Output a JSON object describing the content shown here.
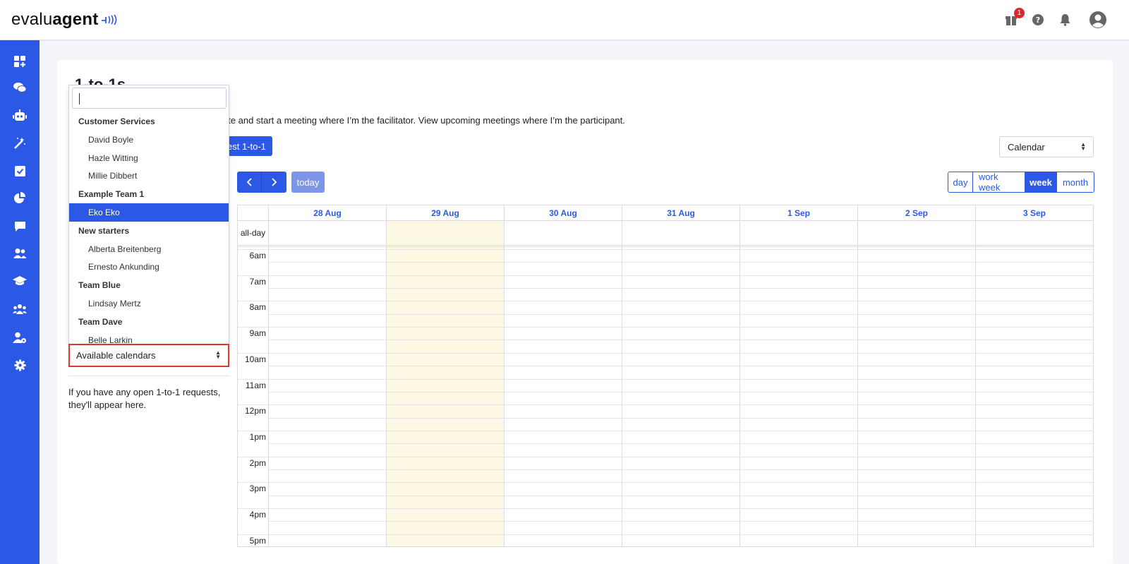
{
  "header": {
    "logo_regular": "evalu",
    "logo_bold": "agent",
    "notification_count": "1",
    "icons": [
      "gift-icon",
      "help-icon",
      "bell-icon",
      "user-avatar-icon"
    ]
  },
  "sidebar": {
    "items": [
      {
        "name": "dashboard-add-icon"
      },
      {
        "name": "chat-bubbles-icon"
      },
      {
        "name": "robot-icon"
      },
      {
        "name": "magic-wand-icon"
      },
      {
        "name": "checkbox-icon"
      },
      {
        "name": "pie-chart-icon"
      },
      {
        "name": "comment-icon"
      },
      {
        "name": "users-icon"
      },
      {
        "name": "graduation-cap-icon"
      },
      {
        "name": "team-icon"
      },
      {
        "name": "user-settings-icon"
      },
      {
        "name": "gear-icon"
      }
    ]
  },
  "main": {
    "title": "1-to-1s",
    "description": "ate and start a meeting where I’m the facilitator. View upcoming meetings where I’m the participant.",
    "request_button": "est 1-to-1",
    "view_select": "Calendar",
    "today_label": "today",
    "view_buttons": [
      "day",
      "work week",
      "week",
      "month"
    ],
    "active_view": "week"
  },
  "calendar": {
    "days": [
      "28 Aug",
      "29 Aug",
      "30 Aug",
      "31 Aug",
      "1 Sep",
      "2 Sep",
      "3 Sep"
    ],
    "today_index": 1,
    "allday_label": "all-day",
    "times": [
      "6am",
      "7am",
      "8am",
      "9am",
      "10am",
      "11am",
      "12pm",
      "1pm",
      "2pm",
      "3pm",
      "4pm",
      "5pm"
    ]
  },
  "dropdown": {
    "search_value": "",
    "items": [
      {
        "type": "group",
        "label": "Customer Services"
      },
      {
        "type": "option",
        "label": "David Boyle"
      },
      {
        "type": "option",
        "label": "Hazle Witting"
      },
      {
        "type": "option",
        "label": "Millie Dibbert"
      },
      {
        "type": "group",
        "label": "Example Team 1"
      },
      {
        "type": "option",
        "label": "Eko Eko",
        "selected": true
      },
      {
        "type": "group",
        "label": "New starters"
      },
      {
        "type": "option",
        "label": "Alberta Breitenberg"
      },
      {
        "type": "option",
        "label": "Ernesto Ankunding"
      },
      {
        "type": "group",
        "label": "Team Blue"
      },
      {
        "type": "option",
        "label": "Lindsay Mertz"
      },
      {
        "type": "group",
        "label": "Team Dave"
      },
      {
        "type": "option",
        "label": "Belle Larkin"
      }
    ],
    "select_label": "Available calendars"
  },
  "requests": {
    "empty_text": "If you have any open 1-to-1 requests, they'll appear here."
  },
  "colors": {
    "primary": "#2b59e6",
    "today_highlight": "#fcf8e3",
    "badge": "#e0242b",
    "focus_border": "#e0382f"
  }
}
